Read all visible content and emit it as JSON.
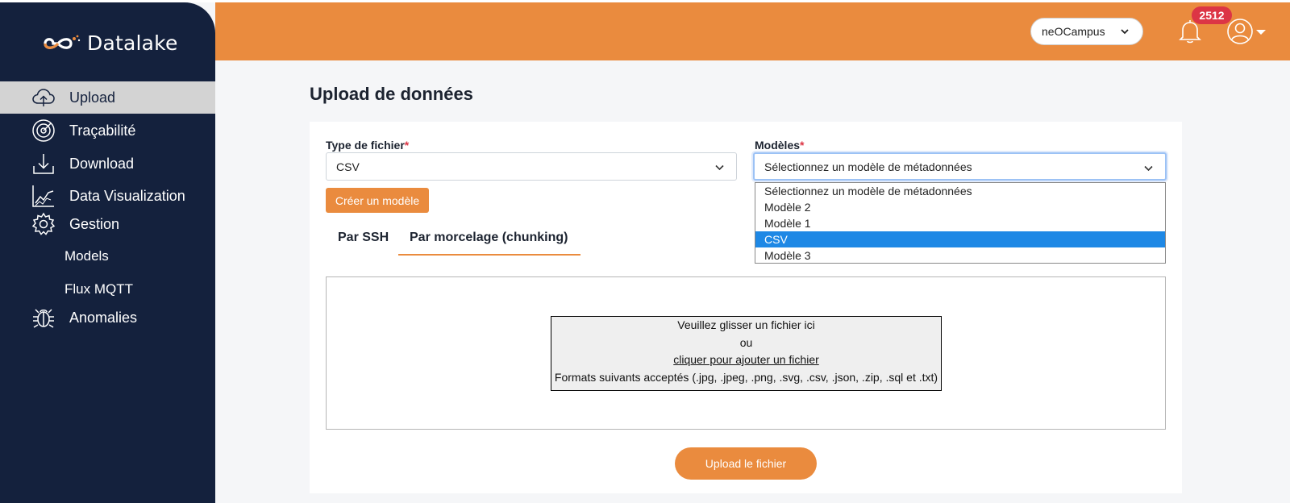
{
  "brand": {
    "name": "Datalake",
    "logo_icon": "infinity-logo-icon"
  },
  "sidebar": {
    "items": [
      {
        "label": "Upload",
        "icon": "cloud-upload-icon",
        "active": true
      },
      {
        "label": "Traçabilité",
        "icon": "radar-icon"
      },
      {
        "label": "Download",
        "icon": "download-icon"
      },
      {
        "label": "Data Visualization",
        "icon": "chart-line-icon"
      },
      {
        "label": "Gestion",
        "icon": "gear-icon"
      },
      {
        "label": "Anomalies",
        "icon": "bug-icon"
      }
    ],
    "subitems": [
      {
        "label": "Models"
      },
      {
        "label": "Flux MQTT"
      }
    ]
  },
  "header": {
    "org_select_value": "neOCampus",
    "notification_count": "2512"
  },
  "page": {
    "title": "Upload de données"
  },
  "form": {
    "file_type": {
      "label": "Type de fichier",
      "required_mark": "*",
      "value": "CSV"
    },
    "model": {
      "label": "Modèles",
      "required_mark": "*",
      "value": "Sélectionnez un modèle de métadonnées",
      "options": [
        "Sélectionnez un modèle de métadonnées",
        "Modèle 2",
        "Modèle 1",
        "CSV",
        "Modèle 3"
      ],
      "highlighted_option": "CSV"
    },
    "create_model_button": "Créer un modèle"
  },
  "tabs": [
    {
      "label": "Par SSH",
      "active": false
    },
    {
      "label": "Par morcelage (chunking)",
      "active": true
    }
  ],
  "dropzone": {
    "line1": "Veuillez glisser un fichier ici",
    "line2": "ou",
    "link": "cliquer pour ajouter un fichier",
    "formats": "Formats suivants acceptés (.jpg, .jpeg, .png, .svg, .csv, .json, .zip, .sql et .txt)"
  },
  "upload_button": "Upload le fichier",
  "colors": {
    "sidebar": "#14213d",
    "accent": "#ea8b3e",
    "badge": "#dc3545",
    "selected_option": "#1e88e5"
  }
}
